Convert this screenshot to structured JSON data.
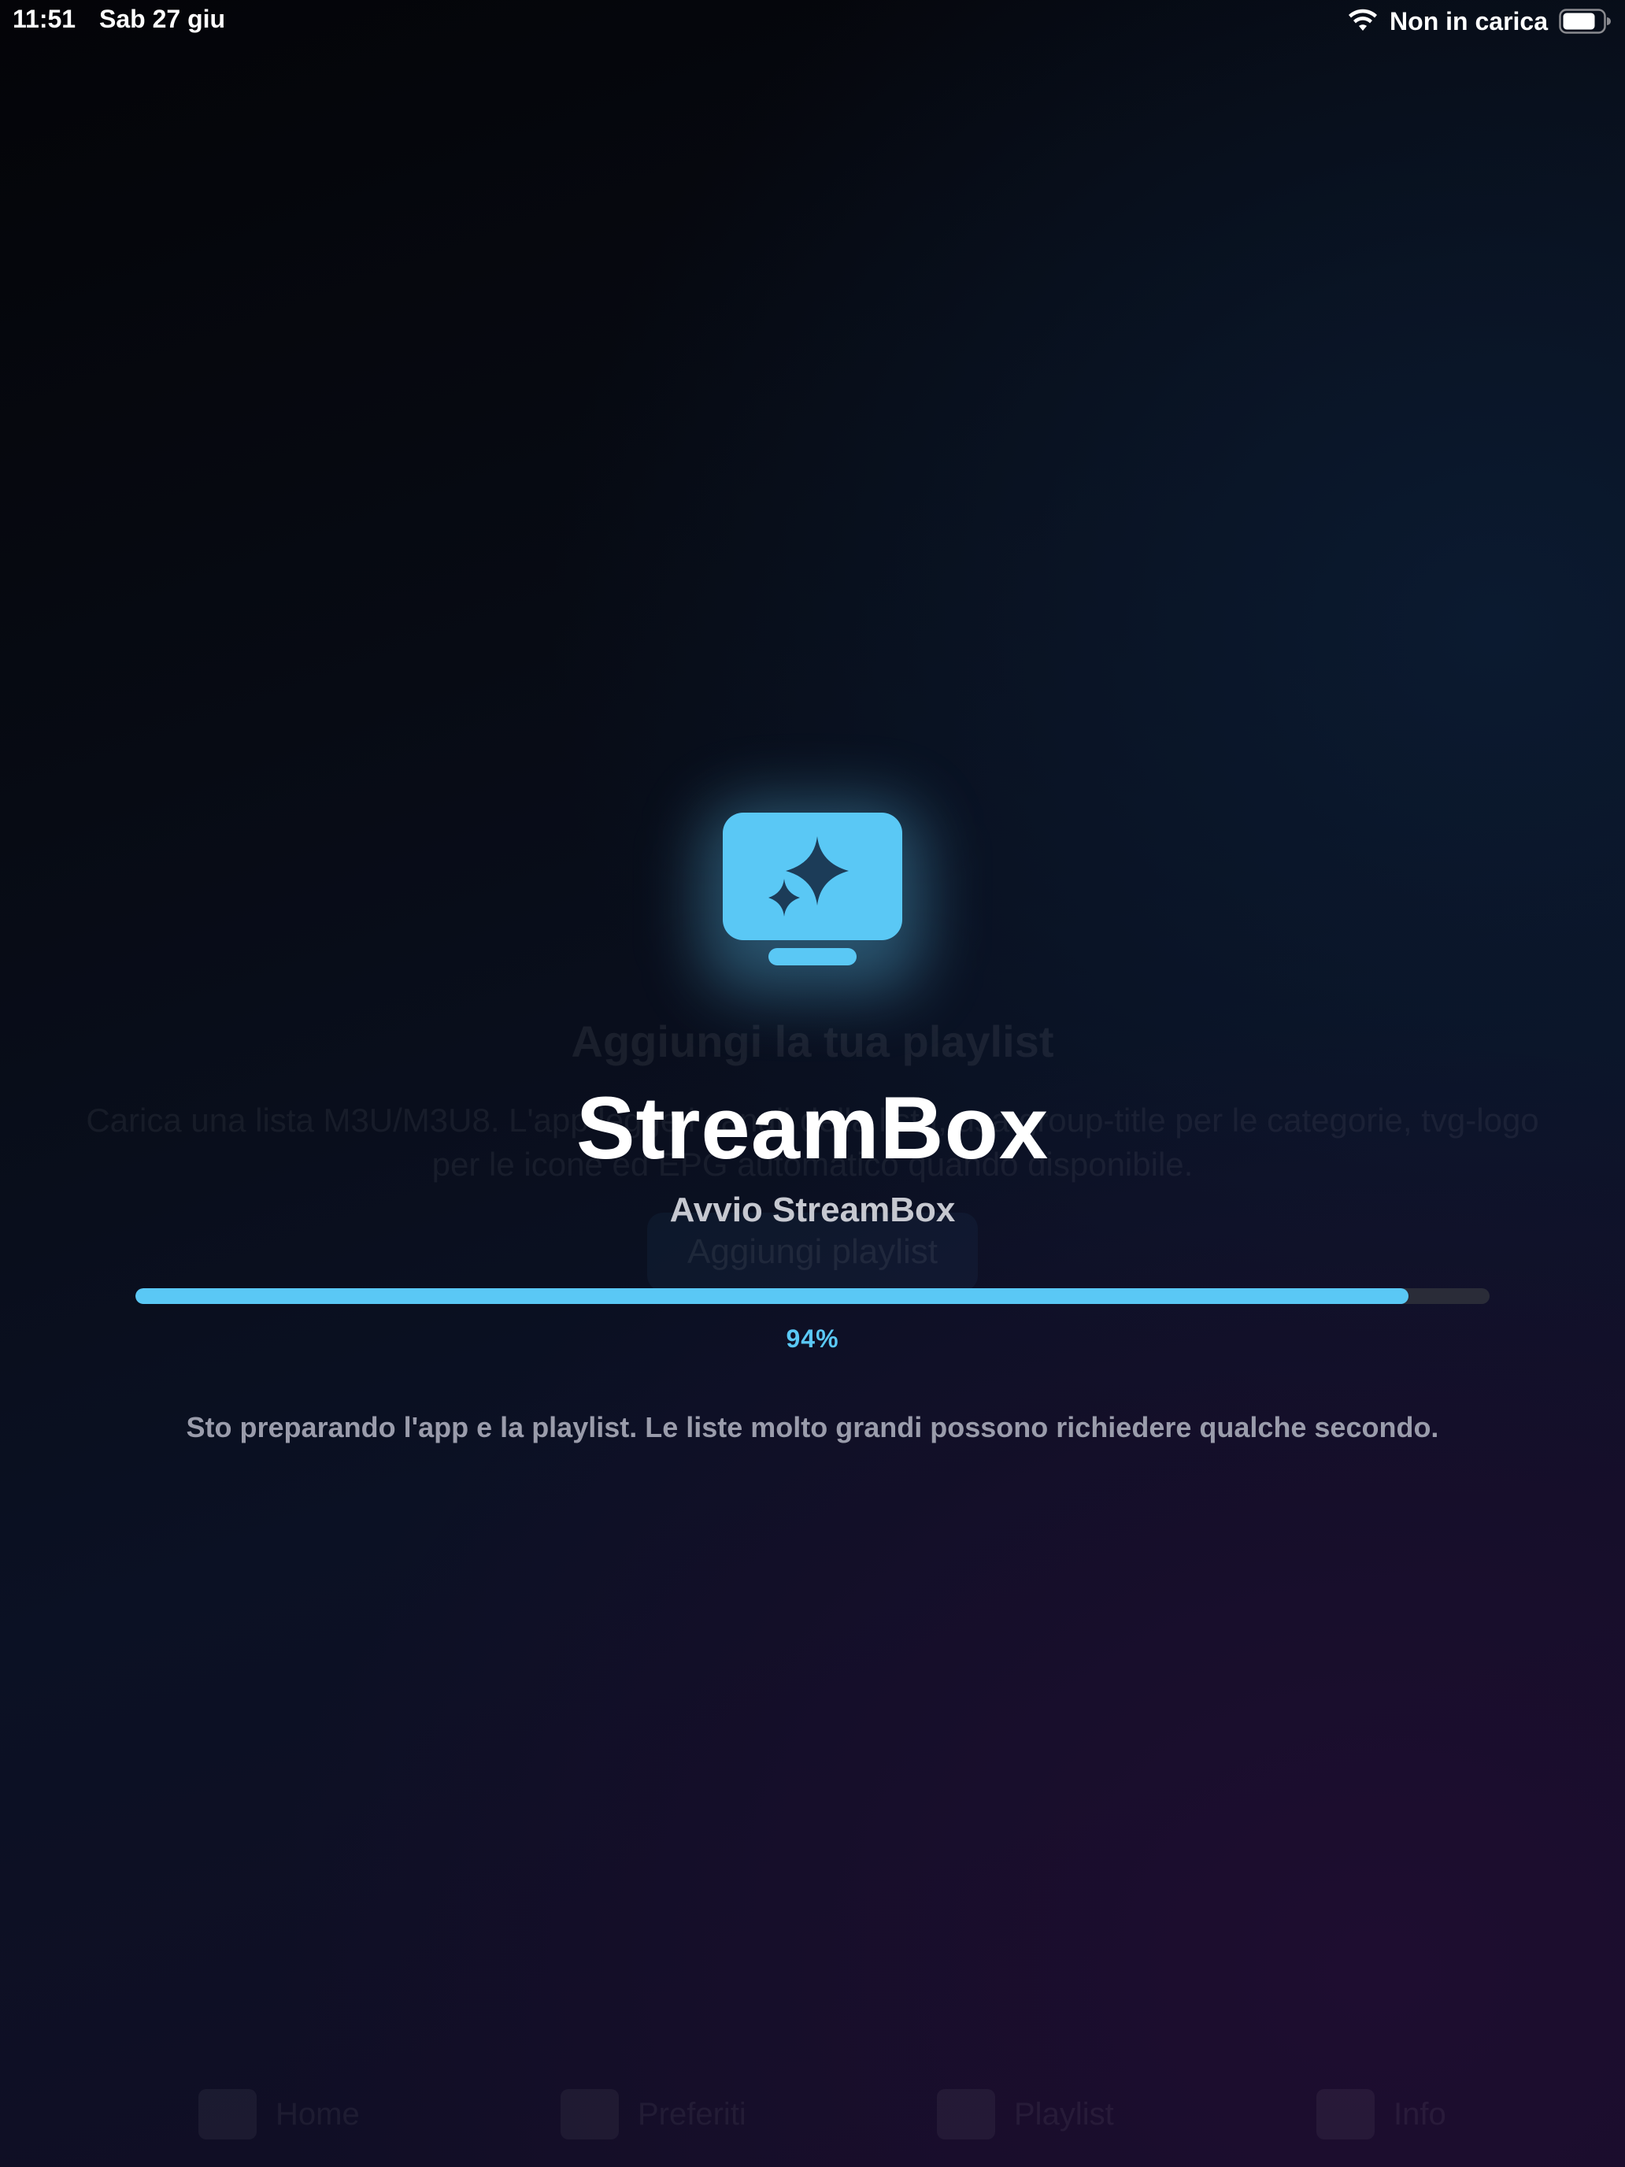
{
  "status_bar": {
    "time": "11:51",
    "date": "Sab 27 giu",
    "charging": "Non in carica",
    "icons": [
      "wifi-icon",
      "battery-icon"
    ]
  },
  "background_screen": {
    "title": "Aggiungi la tua playlist",
    "description": "Carica una lista M3U/M3U8. L'app legge i canali della lista, usa group-title per le categorie, tvg-logo per le icone ed EPG automatico quando disponibile.",
    "add_button": "Aggiungi playlist",
    "tabs": [
      {
        "label": "Home",
        "icon": "tv-icon"
      },
      {
        "label": "Preferiti",
        "icon": "star-icon"
      },
      {
        "label": "Playlist",
        "icon": "folder-icon"
      },
      {
        "label": "Info",
        "icon": "shield-icon"
      }
    ]
  },
  "splash": {
    "logo_icon": "tv-sparkles-icon",
    "title": "StreamBox",
    "subtitle": "Avvio StreamBox",
    "progress": 0.94,
    "progress_label": "94%",
    "message": "Sto preparando l'app e la playlist. Le liste molto grandi possono richiedere qualche secondo."
  },
  "colors": {
    "accent": "#5AC8F5",
    "text_primary": "#FFFFFF",
    "text_secondary": "#C6C8D0",
    "text_muted": "#9A9CAB",
    "track": "#2A2C38"
  }
}
